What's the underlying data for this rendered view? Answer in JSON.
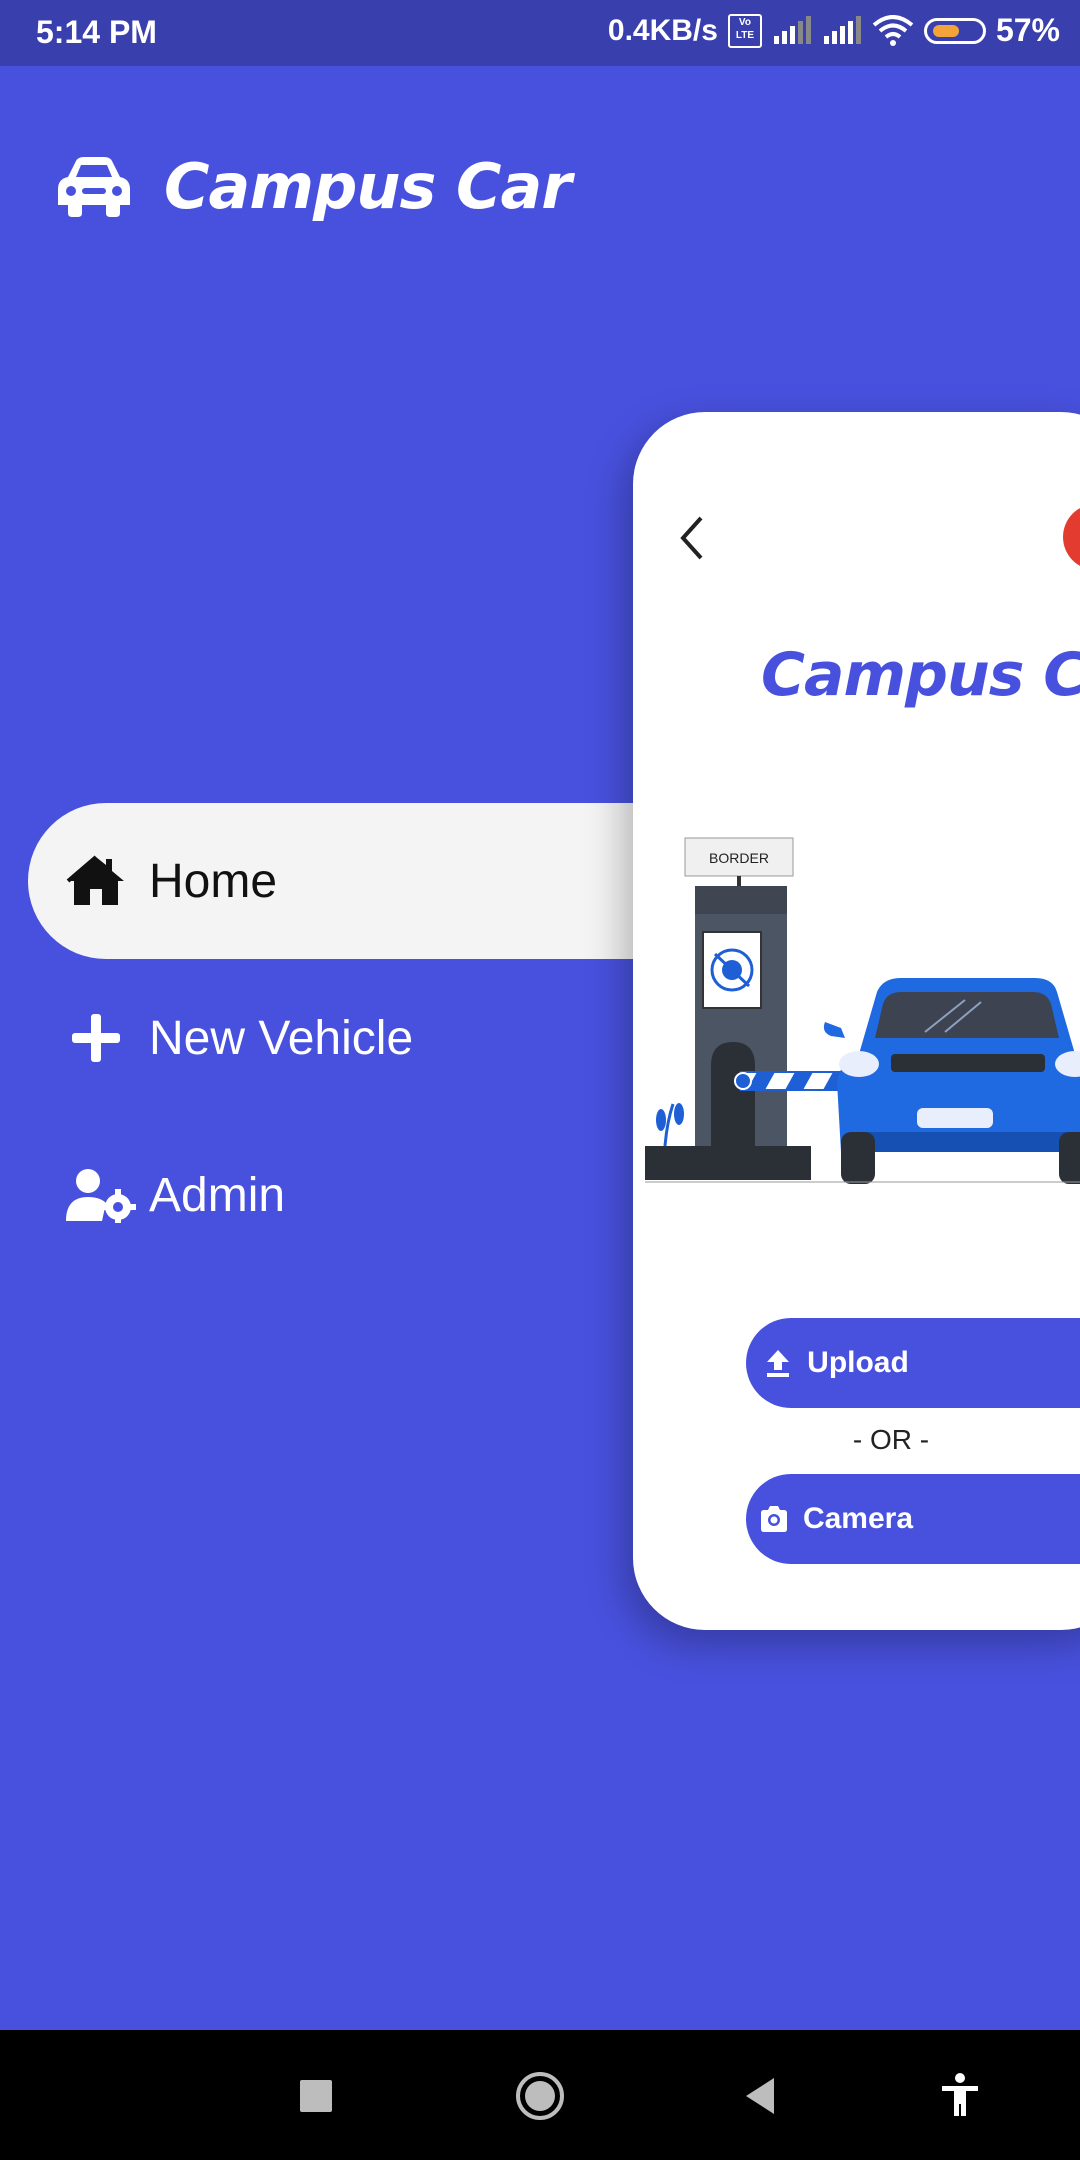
{
  "status_bar": {
    "time": "5:14 PM",
    "net_speed": "0.4KB/s",
    "volte": "Vo LTE",
    "battery_percent": "57%",
    "battery_level": 0.57,
    "icons": [
      "signal-icon",
      "signal-icon",
      "wifi-icon",
      "battery-icon"
    ]
  },
  "drawer": {
    "app_title": "Campus Car",
    "app_icon": "car-icon",
    "items": [
      {
        "label": "Home",
        "icon": "home-icon",
        "active": true
      },
      {
        "label": "New Vehicle",
        "icon": "plus-icon",
        "active": false
      },
      {
        "label": "Admin",
        "icon": "user-gear-icon",
        "active": false
      }
    ]
  },
  "main_card": {
    "title": "Campus Car",
    "back_icon": "chevron-left-icon",
    "illustration": {
      "sign_text": "BORDER"
    },
    "upload_button": {
      "label": "Upload",
      "icon": "upload-icon"
    },
    "or_text": "- OR -",
    "camera_button": {
      "label": "Camera",
      "icon": "camera-icon"
    }
  },
  "nav_bar": {
    "icons": [
      "recents-icon",
      "home-circle-icon",
      "back-triangle-icon",
      "accessibility-icon"
    ]
  },
  "colors": {
    "accent": "#4851de",
    "status_bar": "#3a3fae",
    "drawer_active_bg": "#f4f4f4",
    "red_dot": "#e33b2f"
  }
}
